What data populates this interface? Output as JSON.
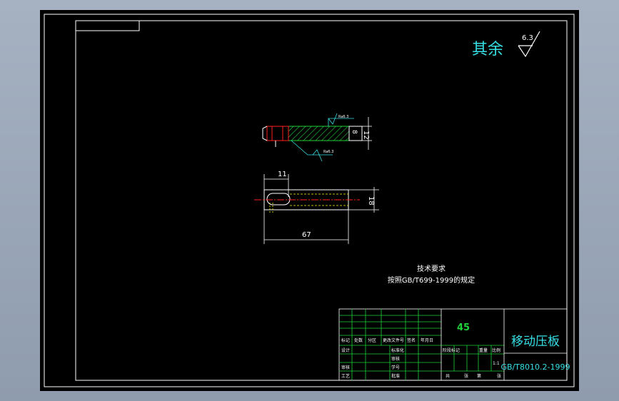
{
  "surface_note": {
    "label": "其余",
    "value": "6.3"
  },
  "dimensions": {
    "width_small": "11",
    "length": "67",
    "height_side": "12",
    "height_top": "18",
    "thickness": "8"
  },
  "roughness_marks": {
    "mark_a": "Ra6.3",
    "mark_b": "Ra6.3"
  },
  "requirements": {
    "heading": "技术要求",
    "line": "按照GB/T699-1999的规定"
  },
  "title_block": {
    "material": "45",
    "part_name": "移动压板",
    "standard": "GB/T8010.2-1999",
    "header_labels": [
      "标记",
      "处数",
      "分区",
      "更改文件号",
      "签名",
      "年月日"
    ],
    "row_labels": [
      "设计",
      "审核",
      "工艺"
    ],
    "mid_labels": [
      "标准化",
      "审核",
      "学号",
      "批准"
    ],
    "stage_labels": [
      "阶段标记",
      "重量",
      "比例"
    ],
    "scale": "1:1",
    "sheet_info": [
      "共",
      "张",
      "第",
      "张"
    ]
  },
  "colors": {
    "outline": "#ffffff",
    "centerline": "#ff2020",
    "hatch": "#1fd33a",
    "hidden": "#ffff00",
    "annotation": "#36e0e6"
  }
}
